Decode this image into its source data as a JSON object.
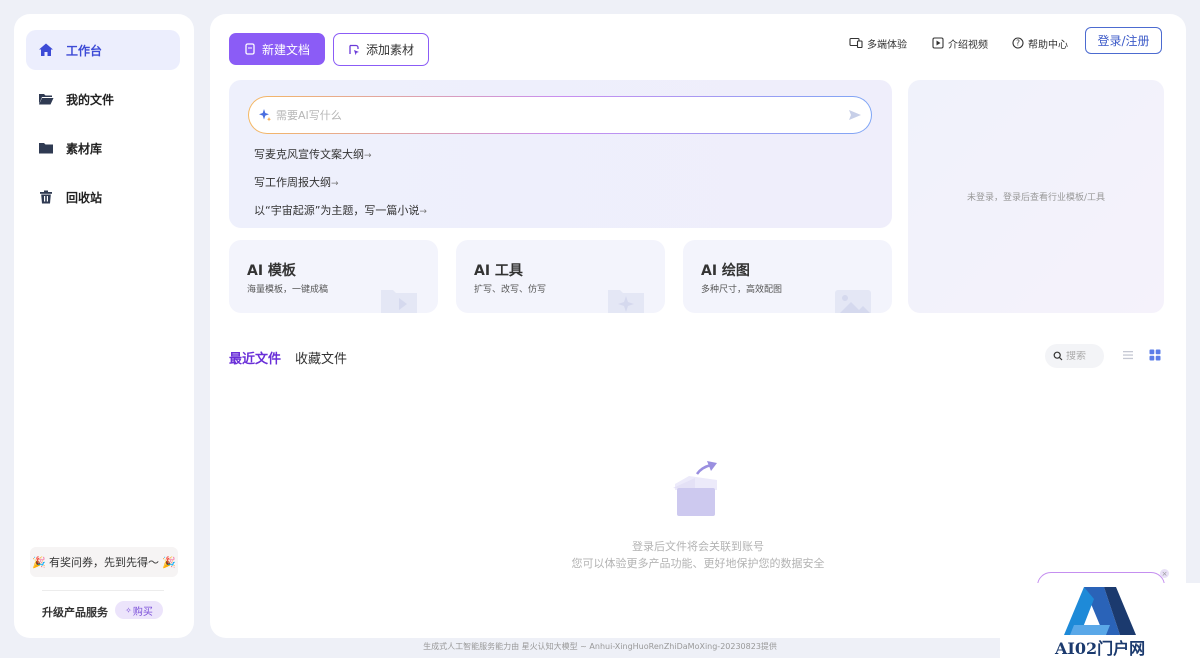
{
  "sidebar": {
    "items": [
      {
        "label": "工作台",
        "icon": "home-icon",
        "active": true
      },
      {
        "label": "我的文件",
        "icon": "folder-open-icon"
      },
      {
        "label": "素材库",
        "icon": "folder-icon"
      },
      {
        "label": "回收站",
        "icon": "trash-icon"
      }
    ],
    "promo": {
      "text": "有奖问券，先到先得～",
      "emoji": "🎉"
    },
    "upgrade_label": "升级产品服务",
    "buy_label": "购买",
    "buy_prefix": "✧"
  },
  "toolbar": {
    "new_doc_label": "新建文档",
    "add_material_label": "添加素材",
    "links": {
      "multi_device": "多端体验",
      "intro_video": "介绍视频",
      "help_center": "帮助中心"
    },
    "login_label": "登录/注册"
  },
  "ai_writer": {
    "placeholder": "需要AI写什么",
    "suggestions": [
      "写麦克风宣传文案大纲",
      "写工作周报大纲",
      "以“宇宙起源”为主题，写一篇小说"
    ],
    "suggestion_arrow": "→"
  },
  "cards": [
    {
      "title": "AI 模板",
      "desc": "海量模板，一键成稿",
      "icon": "template-folder-icon"
    },
    {
      "title": "AI 工具",
      "desc": "扩写、改写、仿写",
      "icon": "tool-folder-icon"
    },
    {
      "title": "AI 绘图",
      "desc": "多种尺寸，高效配图",
      "icon": "image-icon"
    }
  ],
  "right_panel": {
    "text": "未登录，登录后查看行业模板/工具"
  },
  "files": {
    "tabs": {
      "recent": "最近文件",
      "favorites": "收藏文件"
    },
    "search_placeholder": "搜索",
    "empty_line1": "登录后文件将会关联到账号",
    "empty_line2": "您可以体验更多产品功能、更好地保护您的数据安全"
  },
  "footer": {
    "text": "生成式人工智能服务能力由 星火认知大模型 ~ Anhui-XingHuoRenZhiDaMoXing-20230823提供"
  },
  "watermark": {
    "text": "AI02门户网"
  },
  "colors": {
    "accent": "#8b5cf6",
    "active_nav": "#3d4bd6",
    "login": "#3d5bc8"
  }
}
